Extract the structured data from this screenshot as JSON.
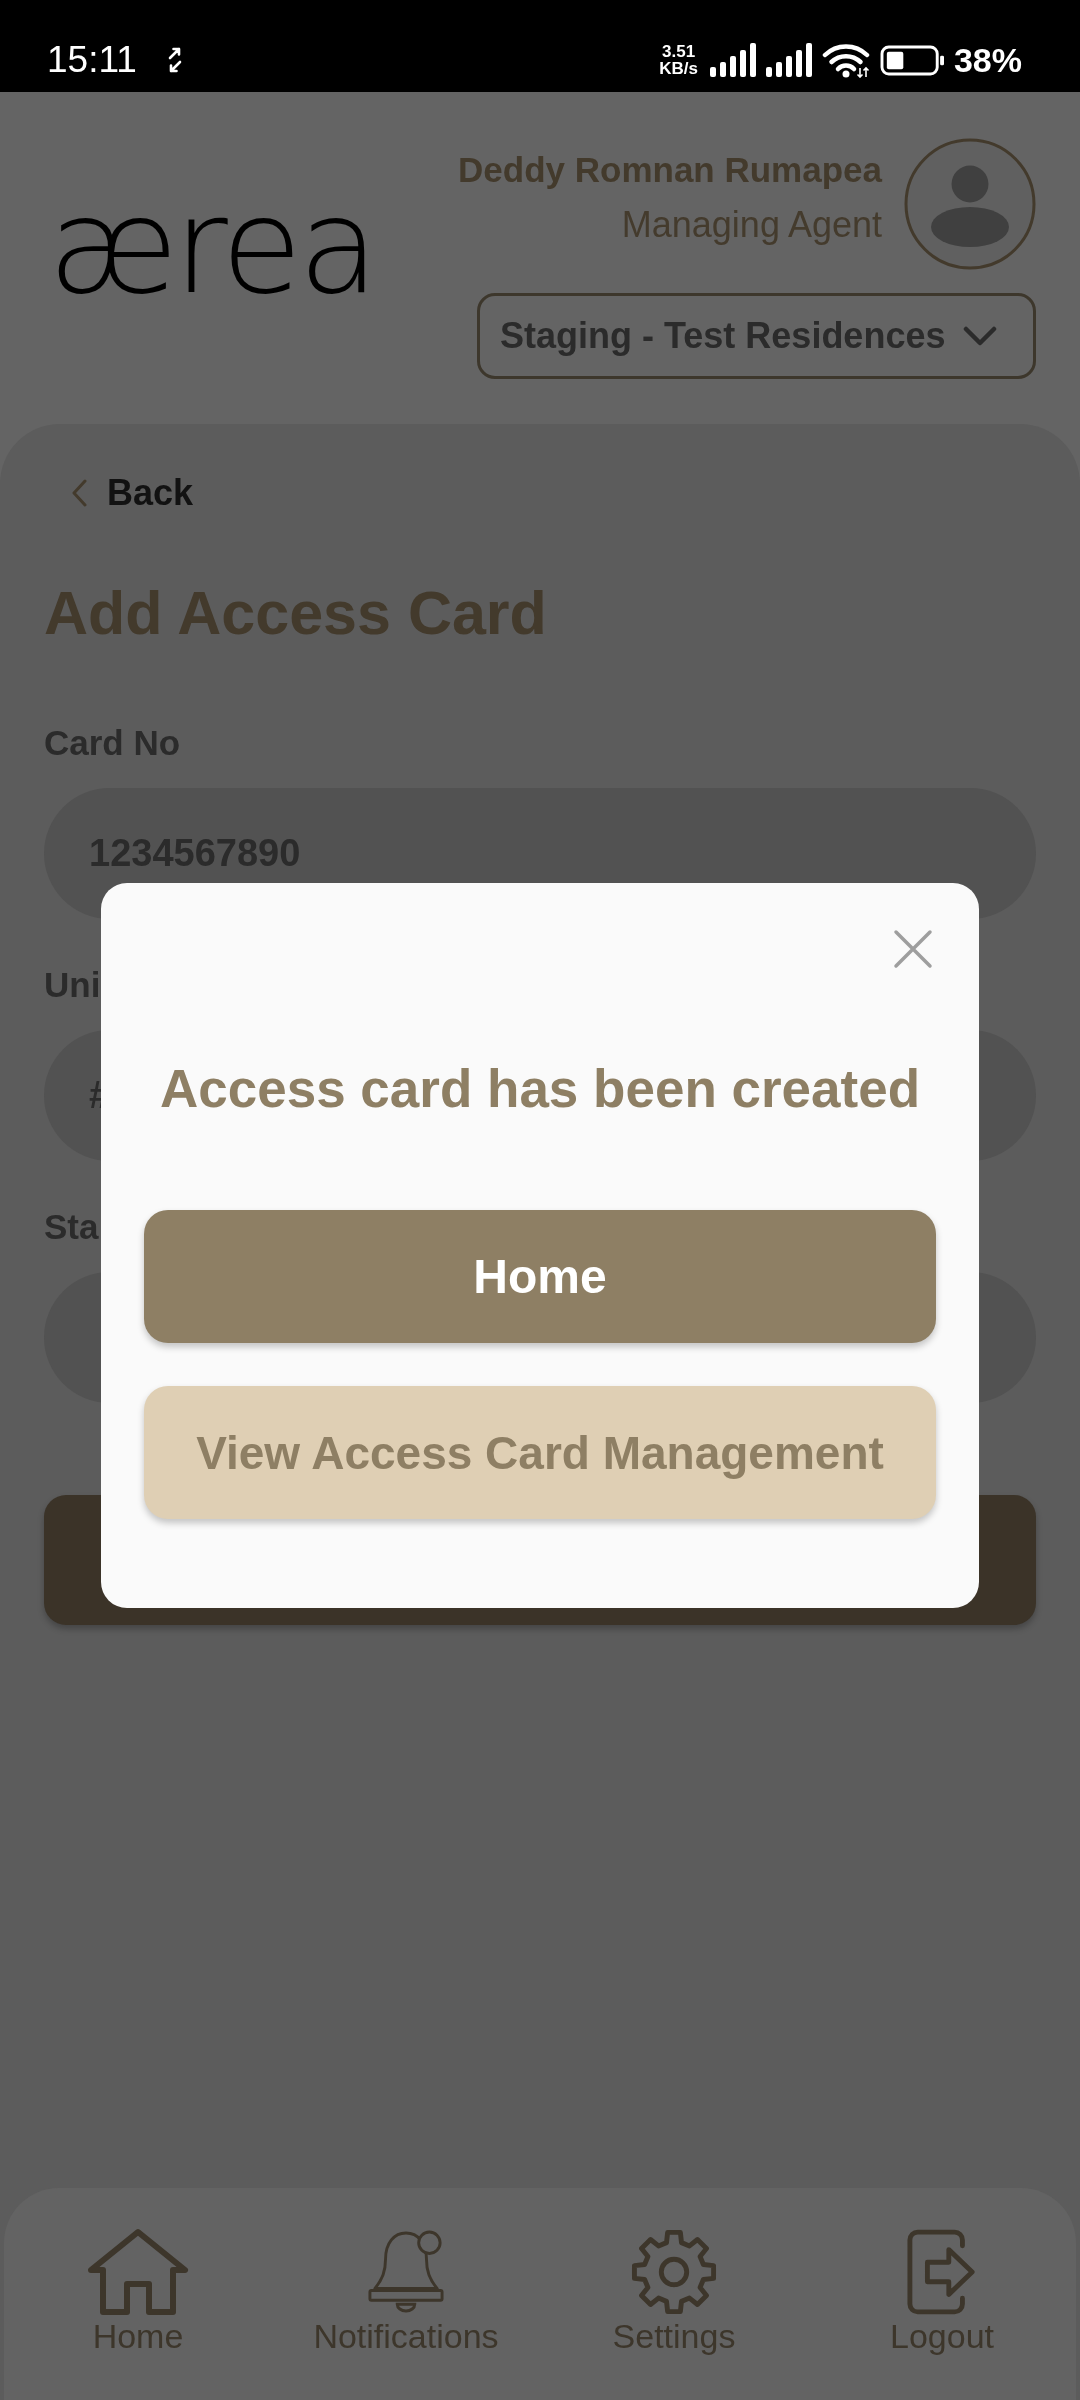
{
  "status_bar": {
    "time": "15:11",
    "net_speed": "3.51",
    "net_speed_unit": "KB/s",
    "battery": "38%"
  },
  "header": {
    "logo": "ærea",
    "user_name": "Deddy Romnan Rumapea",
    "user_role": "Managing Agent",
    "property_select": "Staging - Test Residences"
  },
  "page": {
    "back": "Back",
    "title": "Add Access Card",
    "fields": [
      {
        "label": "Card No",
        "value": "1234567890"
      },
      {
        "label": "Uni",
        "value": "#"
      },
      {
        "label": "Sta"
      }
    ]
  },
  "dialog": {
    "message": "Access card has been created",
    "buttons": [
      {
        "label": "Home",
        "kind": "primary"
      },
      {
        "label": "View Access Card Management",
        "kind": "secondary"
      }
    ]
  },
  "bottom_nav": [
    {
      "label": "Home"
    },
    {
      "label": "Notifications"
    },
    {
      "label": "Settings"
    },
    {
      "label": "Logout"
    }
  ]
}
